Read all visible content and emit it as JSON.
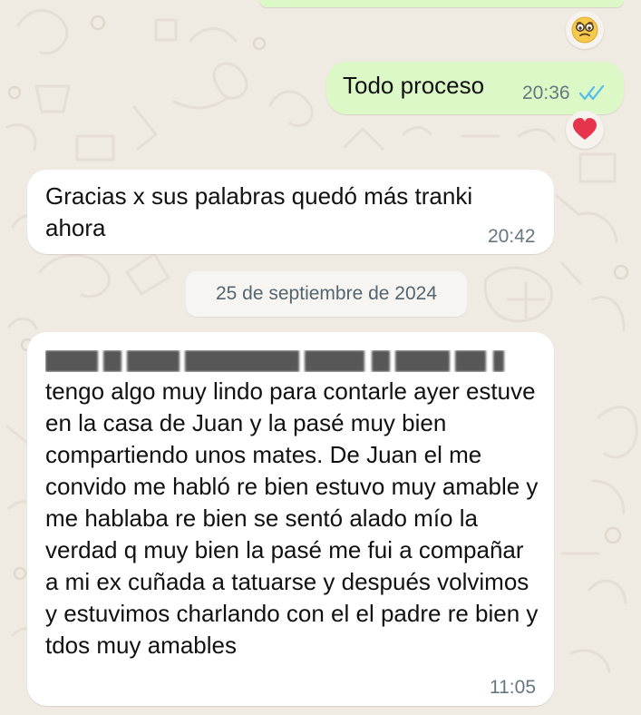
{
  "conversation": {
    "messages": [
      {
        "direction": "outgoing",
        "text": "Todo proceso",
        "time": "20:36",
        "status": "read",
        "reaction": "heart-icon"
      },
      {
        "direction": "incoming",
        "text": "Gracias x sus palabras quedó más tranki ahora",
        "time": "20:42"
      },
      {
        "direction": "incoming",
        "text": "tengo algo muy lindo para contarle ayer estuve en la casa de Juan y la pasé muy bien compartiendo unos mates. De Juan el me convido me habló re bien estuvo muy amable y me hablaba re bien se sentó alado mío la verdad q muy bien la pasé me fui a compañar a mi ex cuñada a tatuarse y después volvimos y estuvimos charlando con el el padre re bien y tdos muy amables",
        "time": "11:05"
      }
    ],
    "date_separator": "25 de septiembre de 2024",
    "top_reaction": "pleading-face-icon"
  },
  "colors": {
    "background": "#efeae2",
    "outgoing_bubble": "#dcf8c6",
    "incoming_bubble": "#ffffff",
    "read_ticks": "#53bdeb",
    "meta_text": "#667781"
  }
}
